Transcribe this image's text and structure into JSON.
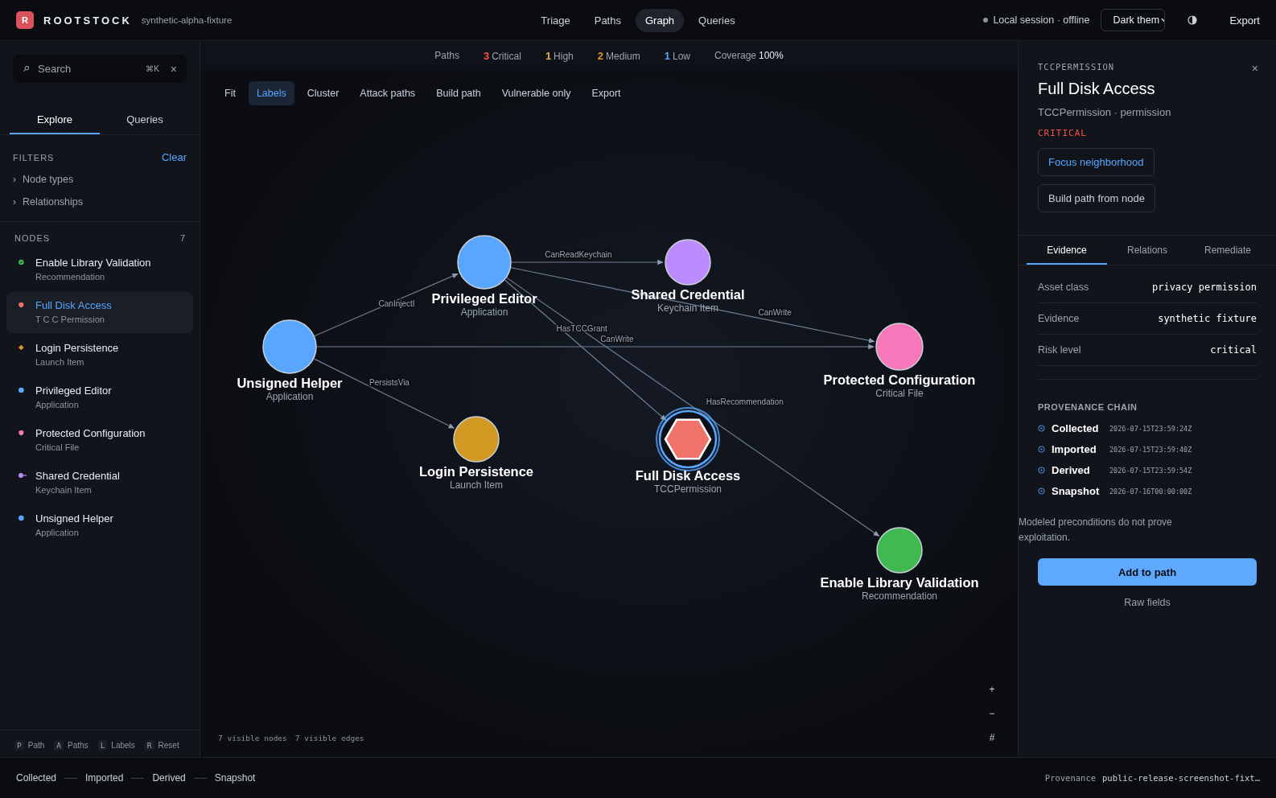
{
  "app": {
    "logo": "R",
    "name": "ROOTSTOCK",
    "workspace": "synthetic-alpha-fixture"
  },
  "nav": [
    {
      "label": "Triage",
      "selected": false
    },
    {
      "label": "Paths",
      "selected": false
    },
    {
      "label": "Graph",
      "selected": true
    },
    {
      "label": "Queries",
      "selected": false
    }
  ],
  "session": "Local session · offline",
  "theme_select": "Dark them",
  "export": "Export",
  "sidebar": {
    "search": {
      "placeholder": "Search",
      "shortcut": "⌘K",
      "clear": "×"
    },
    "tabs": [
      {
        "label": "Explore",
        "selected": true
      },
      {
        "label": "Queries",
        "selected": false
      }
    ],
    "filters": {
      "title": "FILTERS",
      "clear": "Clear",
      "items": [
        {
          "caret": "›",
          "label": "Node types",
          "expanded": false
        },
        {
          "caret": "›",
          "label": "Relationships",
          "expanded": false
        }
      ]
    },
    "nodes_title": "NODES",
    "nodes_count": "7",
    "nodes": [
      {
        "name": "Enable Library Validation",
        "type": "Recommendation",
        "kind": "check",
        "color": "#3fb950",
        "selected": false
      },
      {
        "name": "Full Disk Access",
        "type": "T C C Permission",
        "kind": "shield",
        "color": "#f0736a",
        "selected": true
      },
      {
        "name": "Login Persistence",
        "type": "Launch Item",
        "kind": "diamond",
        "color": "#d29922",
        "selected": false
      },
      {
        "name": "Privileged Editor",
        "type": "Application",
        "kind": "dot",
        "color": "#58a6ff",
        "selected": false
      },
      {
        "name": "Protected Configuration",
        "type": "Critical File",
        "kind": "shield",
        "color": "#f778ba",
        "selected": false
      },
      {
        "name": "Shared Credential",
        "type": "Keychain Item",
        "kind": "key",
        "color": "#bc8cff",
        "selected": false
      },
      {
        "name": "Unsigned Helper",
        "type": "Application",
        "kind": "dot",
        "color": "#58a6ff",
        "selected": false
      }
    ],
    "shortcuts": [
      {
        "key": "P",
        "label": "Path"
      },
      {
        "key": "A",
        "label": "Paths"
      },
      {
        "key": "L",
        "label": "Labels"
      },
      {
        "key": "R",
        "label": "Reset"
      }
    ]
  },
  "summary": {
    "paths_label": "Paths",
    "counts": [
      {
        "value": "3",
        "label": "Critical",
        "color": "#f85149"
      },
      {
        "value": "1",
        "label": "High",
        "color": "#e3b341"
      },
      {
        "value": "2",
        "label": "Medium",
        "color": "#d29922"
      },
      {
        "value": "1",
        "label": "Low",
        "color": "#58a6ff"
      }
    ],
    "coverage_label": "Coverage",
    "coverage": "100%"
  },
  "toolbar": [
    {
      "label": "Fit",
      "selected": false
    },
    {
      "label": "Labels",
      "selected": true
    },
    {
      "label": "Cluster",
      "selected": false
    },
    {
      "label": "Attack paths",
      "selected": false
    },
    {
      "label": "Build path",
      "selected": false
    },
    {
      "label": "Vulnerable only",
      "selected": false
    },
    {
      "label": "Export",
      "selected": false
    }
  ],
  "graph": {
    "nodes": [
      {
        "label": "Unsigned Helper",
        "type": "Application",
        "color": "#58a6ff",
        "kind": "circle",
        "selected": false
      },
      {
        "label": "Privileged Editor",
        "type": "Application",
        "color": "#58a6ff",
        "kind": "circle",
        "selected": false
      },
      {
        "label": "Shared Credential",
        "type": "Keychain Item",
        "color": "#bc8cff",
        "kind": "circle",
        "selected": false
      },
      {
        "label": "Protected Configuration",
        "type": "Critical File",
        "color": "#f778ba",
        "kind": "circle",
        "selected": false
      },
      {
        "label": "Login Persistence",
        "type": "Launch Item",
        "color": "#d29922",
        "kind": "circle",
        "selected": false
      },
      {
        "label": "Full Disk Access",
        "type": "TCCPermission",
        "color": "#f0736a",
        "kind": "hexagon",
        "selected": true
      },
      {
        "label": "Enable Library Validation",
        "type": "Recommendation",
        "color": "#3fb950",
        "kind": "circle",
        "selected": false
      }
    ],
    "edges": [
      {
        "label": "CanReadKeychain"
      },
      {
        "label": "CanInjectI"
      },
      {
        "label": "CanWrite"
      },
      {
        "label": "CanWrite"
      },
      {
        "label": "HasTCCGrant"
      },
      {
        "label": "PersistsVia"
      },
      {
        "label": "HasRecommendation"
      }
    ],
    "footer": [
      "7 visible nodes",
      "7 visible edges"
    ],
    "zoom_controls": [
      "+",
      "−",
      "#"
    ]
  },
  "detail": {
    "kind_label": "TCCPERMISSION",
    "close": "×",
    "title": "Full Disk Access",
    "subtitle": "TCCPermission · permission",
    "severity": "CRITICAL",
    "actions": [
      {
        "label": "Focus neighborhood",
        "primary": true
      },
      {
        "label": "Build path from node",
        "primary": false
      }
    ],
    "tabs": [
      {
        "label": "Evidence",
        "selected": true
      },
      {
        "label": "Relations",
        "selected": false
      },
      {
        "label": "Remediate",
        "selected": false
      }
    ],
    "fields": [
      {
        "label": "Asset class",
        "value": "privacy permission"
      },
      {
        "label": "Evidence",
        "value": "synthetic fixture"
      },
      {
        "label": "Risk level",
        "value": "critical"
      }
    ],
    "provenance_title": "PROVENANCE CHAIN",
    "provenance": [
      {
        "step": "Collected",
        "time": "2026-07-15T23:59:24Z"
      },
      {
        "step": "Imported",
        "time": "2026-07-15T23:59:40Z"
      },
      {
        "step": "Derived",
        "time": "2026-07-15T23:59:54Z"
      },
      {
        "step": "Snapshot",
        "time": "2026-07-16T00:00:00Z"
      }
    ],
    "note": "Modeled preconditions do not prove exploitation.",
    "add_button": "Add to path",
    "raw_fields": "Raw fields"
  },
  "status_bar": {
    "steps": [
      "Collected",
      "Imported",
      "Derived",
      "Snapshot"
    ],
    "provenance_label": "Provenance",
    "provenance_value": "public-release-screenshot-fixt…"
  }
}
